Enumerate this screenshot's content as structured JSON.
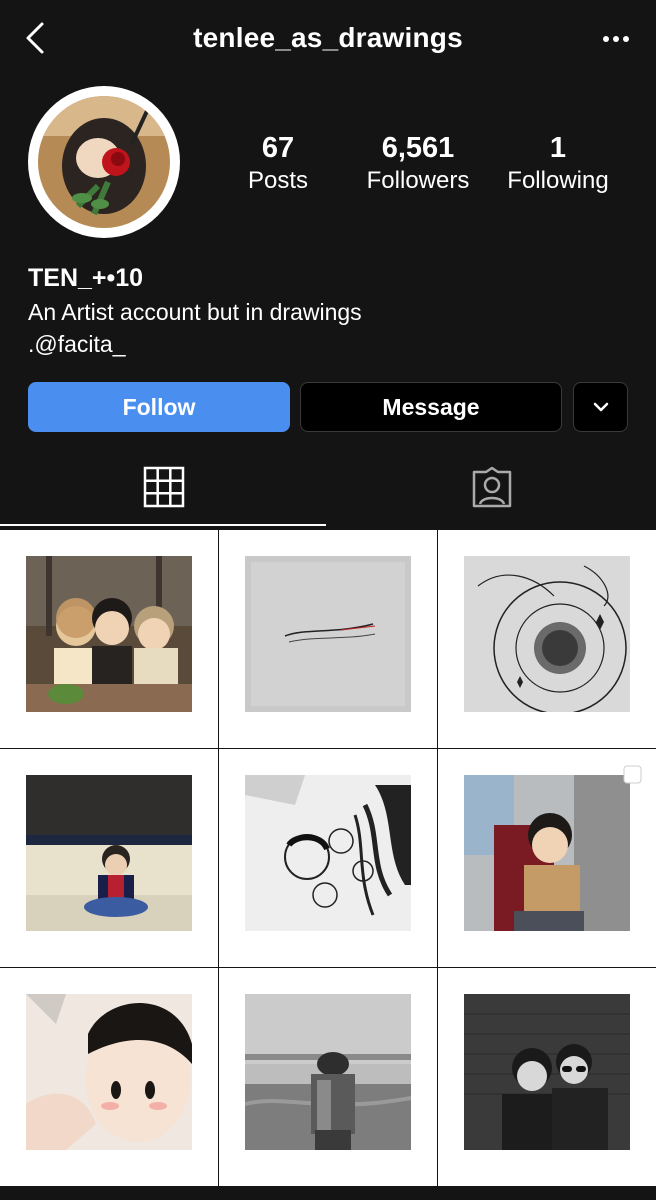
{
  "header": {
    "username": "tenlee_as_drawings",
    "back_icon": "chevron-left-icon",
    "more_icon": "more-horizontal-icon"
  },
  "profile": {
    "display_name": "TEN_+•10",
    "bio_line1": "An Artist account but in drawings",
    "bio_line2": ".@facita_",
    "stats": {
      "posts": {
        "value": "67",
        "label": "Posts"
      },
      "followers": {
        "value": "6,561",
        "label": "Followers"
      },
      "following": {
        "value": "1",
        "label": "Following"
      }
    }
  },
  "actions": {
    "follow_label": "Follow",
    "message_label": "Message",
    "dropdown_icon": "chevron-down-icon"
  },
  "tabs": [
    {
      "name": "grid",
      "icon": "grid-icon",
      "active": true
    },
    {
      "name": "tagged",
      "icon": "tagged-person-icon",
      "active": false
    }
  ],
  "colors": {
    "background": "#141414",
    "follow_blue": "#4a8ff0",
    "text": "#ffffff"
  },
  "posts": [
    {
      "subject": "three friends eating together (color)",
      "multi": false
    },
    {
      "subject": "grey paper with handwritten note",
      "multi": false
    },
    {
      "subject": "line drawing of a plate",
      "multi": false
    },
    {
      "subject": "boy sitting in a hallway (color)",
      "multi": false
    },
    {
      "subject": "ink drawing of flowers and hair",
      "multi": false
    },
    {
      "subject": "boy on red armchair (color)",
      "multi": true
    },
    {
      "subject": "close-up of boy's face",
      "multi": false
    },
    {
      "subject": "figure by the sea with bridge (grayscale)",
      "multi": false
    },
    {
      "subject": "two boys against brick wall (grayscale)",
      "multi": false
    }
  ]
}
